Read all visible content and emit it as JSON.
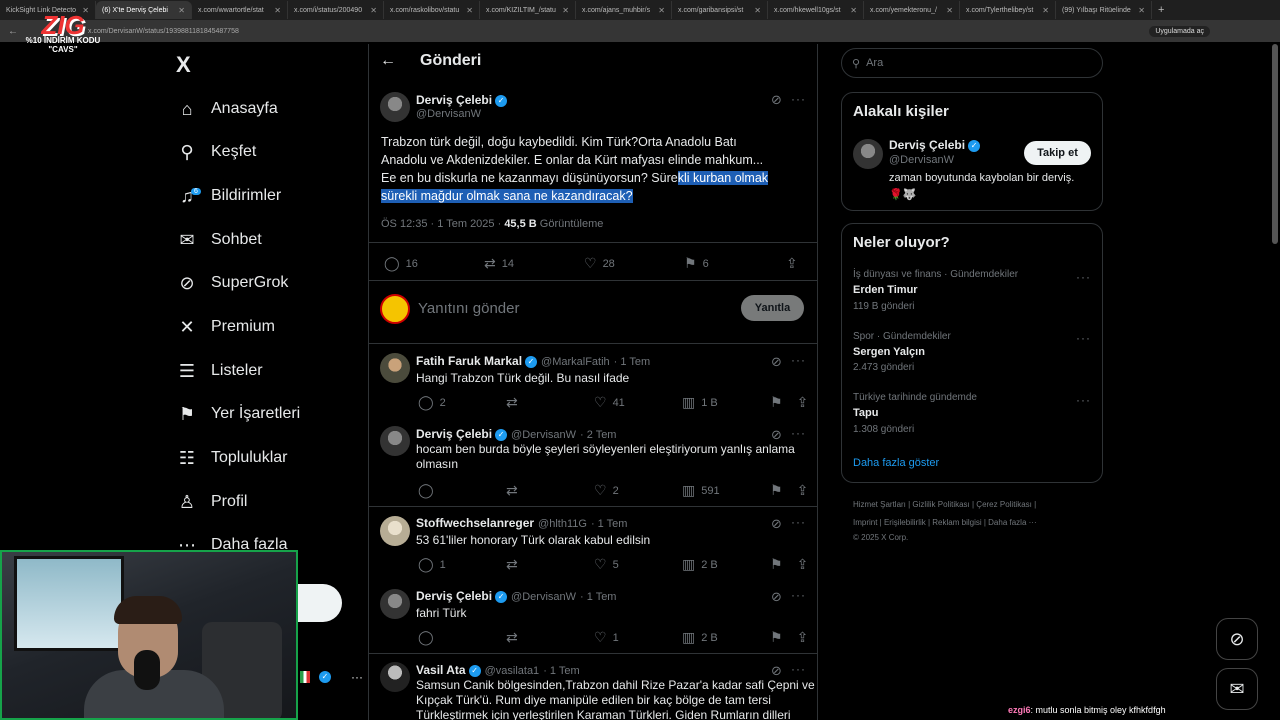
{
  "browser": {
    "tabs": [
      {
        "label": "KickSight Link Detecto"
      },
      {
        "label": "(6) X'te Derviş Çelebi"
      },
      {
        "label": "x.com/wwartortle/stat"
      },
      {
        "label": "x.com/i/status/200490"
      },
      {
        "label": "x.com/raskolibov/statu"
      },
      {
        "label": "x.com/KIZILTIM_/statu"
      },
      {
        "label": "x.com/ajans_muhbir/s"
      },
      {
        "label": "x.com/garibansipsi/st"
      },
      {
        "label": "x.com/hkewell10gs/st"
      },
      {
        "label": "x.com/yemekteronu_/"
      },
      {
        "label": "x.com/Tylerthelibey/st"
      },
      {
        "label": "(99) Yılbaşı Ritüelinde"
      }
    ],
    "url": "x.com/DervisanW/status/1939881181845487758",
    "apps_label": "Uygulamada aç"
  },
  "overlay": {
    "brand": "ZIG",
    "promo": "%10 İNDİRİM KODU",
    "code": "\"CAVS\"",
    "chat_user": "ezgi6",
    "chat_msg": ": mutlu sonla bitmiş oley kfhkfdfgh"
  },
  "nav": {
    "logo": "X",
    "items": [
      {
        "icon": "home-icon",
        "label": "Anasayfa"
      },
      {
        "icon": "search-icon",
        "label": "Keşfet"
      },
      {
        "icon": "bell-icon",
        "label": "Bildirimler",
        "badge": "6"
      },
      {
        "icon": "mail-icon",
        "label": "Sohbet"
      },
      {
        "icon": "grok-icon",
        "label": "SuperGrok"
      },
      {
        "icon": "x-premium-icon",
        "label": "Premium"
      },
      {
        "icon": "list-icon",
        "label": "Listeler"
      },
      {
        "icon": "bookmark-icon",
        "label": "Yer İşaretleri"
      },
      {
        "icon": "communities-icon",
        "label": "Topluluklar"
      },
      {
        "icon": "profile-icon",
        "label": "Profil"
      },
      {
        "icon": "more-icon",
        "label": "Daha fazla"
      }
    ],
    "post_button_partial": "a"
  },
  "main": {
    "header": "Gönderi",
    "post": {
      "author": "Derviş Çelebi",
      "handle": "@DervisanW",
      "text_line1": "Trabzon türk değil, doğu kaybedildi. Kim Türk?Orta Anadolu  Batı",
      "text_line2": "Anadolu ve  Akdenizdekiler. E onlar da Kürt mafyası elinde mahkum...",
      "text_line3a": " Ee en bu diskurla ne kazanmayı düşünüyorsun? Süre",
      "text_line3b": "kli kurban olmak ",
      "text_line4": "sürekli mağdur olmak sana ne kazandıracak?",
      "time": "ÖS 12:35 · 1 Tem 2025 · ",
      "views": "45,5 B",
      "views_label": " Görüntüleme",
      "replies": "16",
      "reposts": "14",
      "likes": "28",
      "bookmarks": "6"
    },
    "reply_box": {
      "placeholder": "Yanıtını gönder",
      "button": "Yanıtla"
    },
    "replies": [
      {
        "author": "Fatih Faruk Markal",
        "handle": "@MarkalFatih",
        "time": "· 1 Tem",
        "text1": "Hangi Trabzon Türk değil. Bu nasıl ifade",
        "text2": "",
        "replies": "2",
        "reposts": "",
        "likes": "41",
        "views": "1 B"
      },
      {
        "author": "Derviş Çelebi",
        "handle": "@DervisanW",
        "time": "· 2 Tem",
        "text1": "hocam ben burda böyle şeyleri söyleyenleri eleştiriyorum yanlış anlama",
        "text2": "olmasın",
        "replies": "",
        "reposts": "",
        "likes": "2",
        "views": "591"
      },
      {
        "author": "Stoffwechselanreger",
        "handle": "@hlth11G",
        "time": "· 1 Tem",
        "text1": "53 61'liler honorary Türk olarak kabul edilsin",
        "text2": "",
        "replies": "1",
        "reposts": "",
        "likes": "5",
        "views": "2 B"
      },
      {
        "author": "Derviş Çelebi",
        "handle": "@DervisanW",
        "time": "· 1 Tem",
        "text1": "fahri Türk",
        "text2": "",
        "replies": "",
        "reposts": "",
        "likes": "1",
        "views": "2 B"
      },
      {
        "author": "Vasil Ata",
        "handle": "@vasilata1",
        "time": "· 1 Tem",
        "text1": "Samsun Canik bölgesinden,Trabzon dahil Rize Pazar'a kadar safi Çepni ve",
        "text2": "Kıpçak Türk'ü. Rum diye manipüle edilen bir kaç bölge de tam tersi",
        "text3": "Türkleştirmek için yerleştirilen Karaman Türkleri. Giden Rumların dilleri"
      }
    ]
  },
  "right": {
    "search_placeholder": "Ara",
    "related_title": "Alakalı kişiler",
    "related": {
      "name": "Derviş Çelebi",
      "handle": "@DervisanW",
      "follow": "Takip et",
      "bio": "zaman boyutunda kaybolan bir derviş.",
      "emoji": "🌹🐺"
    },
    "trends_title": "Neler oluyor?",
    "trends": [
      {
        "context": "İş dünyası ve finans · Gündemdekiler",
        "title": "Erden Timur",
        "count": "119 B gönderi"
      },
      {
        "context": "Spor · Gündemdekiler",
        "title": "Sergen Yalçın",
        "count": "2.473 gönderi"
      },
      {
        "context": "Türkiye tarihinde gündemde",
        "title": "Tapu",
        "count": "1.308 gönderi"
      }
    ],
    "show_more": "Daha fazla göster",
    "footer1": "Hizmet Şartları  |   Gizlilik Politikası  |   Çerez Politikası  |",
    "footer2": "Imprint  |   Erişilebilirlik  |   Reklam bilgisi  |   Daha fazla ···",
    "footer3": "© 2025 X Corp."
  }
}
